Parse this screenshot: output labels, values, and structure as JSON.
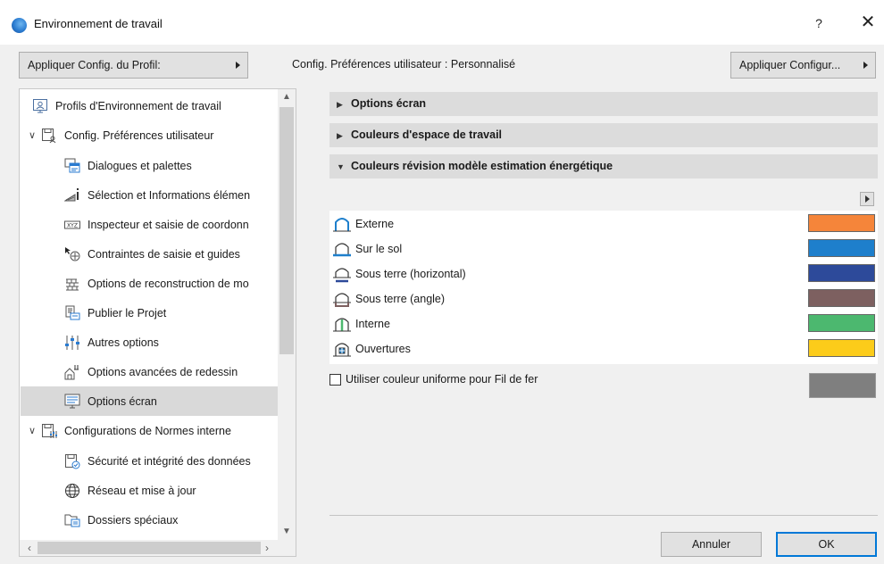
{
  "window": {
    "title": "Environnement de travail",
    "help_label": "?",
    "close_label": "✕"
  },
  "toolbar": {
    "apply_profile_label": "Appliquer Config. du Profil:",
    "config_label": "Config. Préférences utilisateur : Personnalisé",
    "apply_config_label": "Appliquer Configur..."
  },
  "tree": {
    "items": [
      {
        "label": "Profils d'Environnement de travail",
        "icon": "profile-icon"
      },
      {
        "label": "Config. Préférences utilisateur",
        "icon": "user-prefs-icon",
        "expanded": true
      },
      {
        "label": "Dialogues et palettes",
        "icon": "dialogs-icon"
      },
      {
        "label": "Sélection et Informations élémen",
        "icon": "selection-info-icon"
      },
      {
        "label": "Inspecteur et saisie de coordonn",
        "icon": "xyz-icon"
      },
      {
        "label": "Contraintes de saisie et guides",
        "icon": "constraints-icon"
      },
      {
        "label": "Options de reconstruction de mo",
        "icon": "rebuild-icon"
      },
      {
        "label": "Publier le Projet",
        "icon": "publish-icon"
      },
      {
        "label": "Autres options",
        "icon": "sliders-icon"
      },
      {
        "label": "Options avancées de redessin",
        "icon": "redraw-icon"
      },
      {
        "label": "Options écran",
        "icon": "screen-icon",
        "selected": true
      },
      {
        "label": "Configurations de Normes  interne",
        "icon": "standards-icon",
        "expanded": true
      },
      {
        "label": "Sécurité et intégrité des données",
        "icon": "security-icon"
      },
      {
        "label": "Réseau et mise à jour",
        "icon": "globe-icon"
      },
      {
        "label": "Dossiers spéciaux",
        "icon": "folders-icon"
      }
    ]
  },
  "sections": [
    {
      "label": "Options écran",
      "expanded": false
    },
    {
      "label": "Couleurs d'espace de travail",
      "expanded": false
    },
    {
      "label": "Couleurs révision modèle estimation énergétique",
      "expanded": true
    }
  ],
  "colors": [
    {
      "label": "Externe",
      "color": "#f5853a"
    },
    {
      "label": "Sur le sol",
      "color": "#1e7fcc"
    },
    {
      "label": "Sous terre (horizontal)",
      "color": "#2d4a9a"
    },
    {
      "label": "Sous terre (angle)",
      "color": "#7d6060"
    },
    {
      "label": "Interne",
      "color": "#4cb86f"
    },
    {
      "label": "Ouvertures",
      "color": "#fccc1a"
    }
  ],
  "uniform": {
    "label": "Utiliser couleur uniforme pour Fil de fer",
    "checked": false,
    "color": "#7f7f7f"
  },
  "buttons": {
    "cancel": "Annuler",
    "ok": "OK"
  }
}
